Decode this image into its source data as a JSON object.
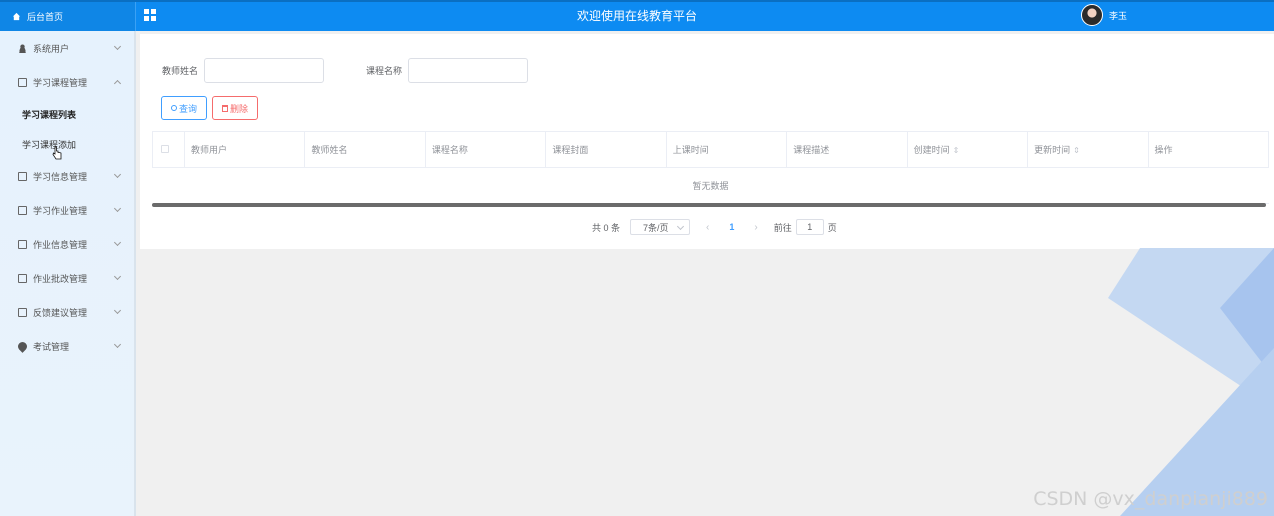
{
  "header": {
    "home_label": "后台首页",
    "title": "欢迎使用在线教育平台",
    "user_name": "李玉"
  },
  "sidebar": {
    "items": [
      {
        "label": "系统用户",
        "icon": "user-icon",
        "expanded": false
      },
      {
        "label": "学习课程管理",
        "icon": "doc-icon",
        "expanded": true
      },
      {
        "label": "学习信息管理",
        "icon": "doc-icon",
        "expanded": false
      },
      {
        "label": "学习作业管理",
        "icon": "doc-icon",
        "expanded": false
      },
      {
        "label": "作业信息管理",
        "icon": "doc-icon",
        "expanded": false
      },
      {
        "label": "作业批改管理",
        "icon": "doc-icon",
        "expanded": false
      },
      {
        "label": "反馈建议管理",
        "icon": "doc-icon",
        "expanded": false
      },
      {
        "label": "考试管理",
        "icon": "pin-icon",
        "expanded": false
      }
    ],
    "sub_items": [
      {
        "label": "学习课程列表",
        "active": true
      },
      {
        "label": "学习课程添加",
        "active": false
      }
    ]
  },
  "search": {
    "teacher_name_label": "教师姓名",
    "teacher_name_value": "",
    "course_name_label": "课程名称",
    "course_name_value": "",
    "query_label": "查询",
    "delete_label": "删除"
  },
  "table": {
    "columns": [
      "教师用户",
      "教师姓名",
      "课程名称",
      "课程封面",
      "上课时间",
      "课程描述",
      "创建时间",
      "更新时间",
      "操作"
    ],
    "empty_text": "暂无数据"
  },
  "pagination": {
    "total_text": "共 0 条",
    "page_size": "7条/页",
    "current_page": "1",
    "goto_label": "前往",
    "goto_value": "1",
    "page_unit": "页"
  },
  "watermark": "CSDN @vx_danpianji889",
  "colors": {
    "header_bg": "#0d8bf2",
    "primary": "#409eff",
    "danger": "#f56c6c",
    "sidebar_bg": "#e6f2fd"
  }
}
